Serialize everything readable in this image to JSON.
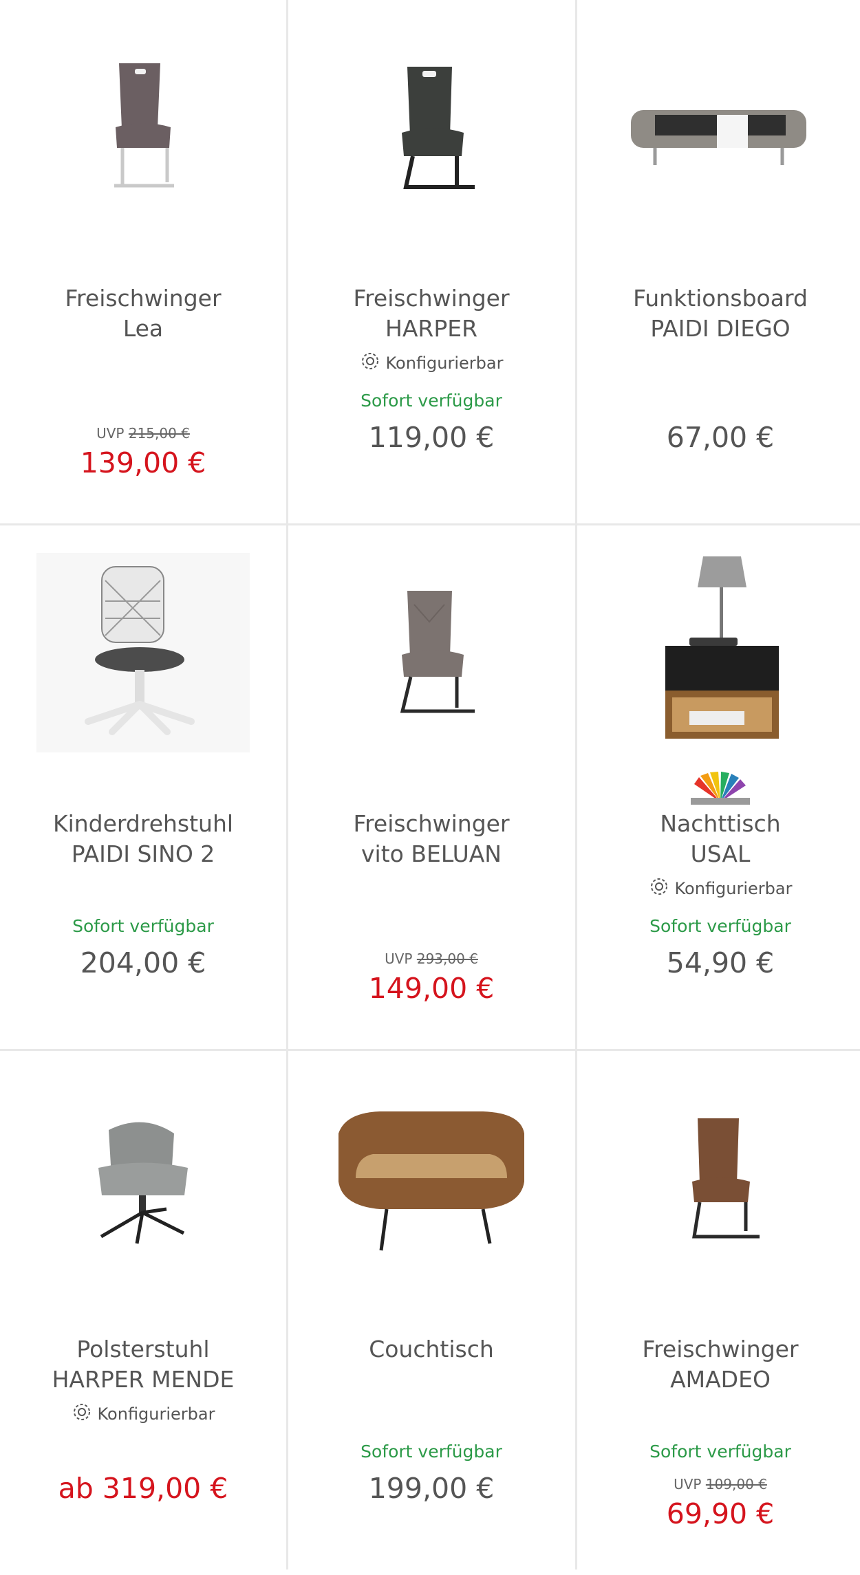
{
  "products": [
    {
      "title_line1": "Freischwinger",
      "title_line2": "Lea",
      "configurable": "",
      "availability": "",
      "uvp_label": "UVP",
      "uvp_price": "215,00 €",
      "price": "139,00 €"
    },
    {
      "title_line1": "Freischwinger",
      "title_line2": "HARPER",
      "configurable": "Konfigurierbar",
      "availability": "Sofort verfügbar",
      "uvp_label": "",
      "uvp_price": "",
      "price": "119,00 €"
    },
    {
      "title_line1": "Funktionsboard",
      "title_line2": "PAIDI DIEGO",
      "configurable": "",
      "availability": "",
      "uvp_label": "",
      "uvp_price": "",
      "price": "67,00 €"
    },
    {
      "title_line1": "Kinderdrehstuhl",
      "title_line2": "PAIDI SINO 2",
      "configurable": "",
      "availability": "Sofort verfügbar",
      "uvp_label": "",
      "uvp_price": "",
      "price": "204,00 €"
    },
    {
      "title_line1": "Freischwinger",
      "title_line2": "vito BELUAN",
      "configurable": "",
      "availability": "",
      "uvp_label": "UVP",
      "uvp_price": "293,00 €",
      "price": "149,00 €"
    },
    {
      "title_line1": "Nachttisch",
      "title_line2": "USAL",
      "configurable": "Konfigurierbar",
      "availability": "Sofort verfügbar",
      "uvp_label": "",
      "uvp_price": "",
      "price": "54,90 €"
    },
    {
      "title_line1": "Polsterstuhl",
      "title_line2": "HARPER MENDE",
      "configurable": "Konfigurierbar",
      "availability": "",
      "uvp_label": "",
      "uvp_price": "",
      "price": "ab 319,00 €"
    },
    {
      "title_line1": "Couchtisch",
      "title_line2": "",
      "configurable": "",
      "availability": "Sofort verfügbar",
      "uvp_label": "",
      "uvp_price": "",
      "price": "199,00 €"
    },
    {
      "title_line1": "Freischwinger",
      "title_line2": "AMADEO",
      "configurable": "",
      "availability": "Sofort verfügbar",
      "uvp_label": "UVP",
      "uvp_price": "109,00 €",
      "price": "69,90 €"
    }
  ],
  "colors": {
    "sale": "#d5141d",
    "available": "#2c9a48",
    "text": "#555555",
    "divider": "#e8e8e8"
  },
  "icons": {
    "configurable": "gear-icon",
    "color_options": "color-fan-icon"
  }
}
